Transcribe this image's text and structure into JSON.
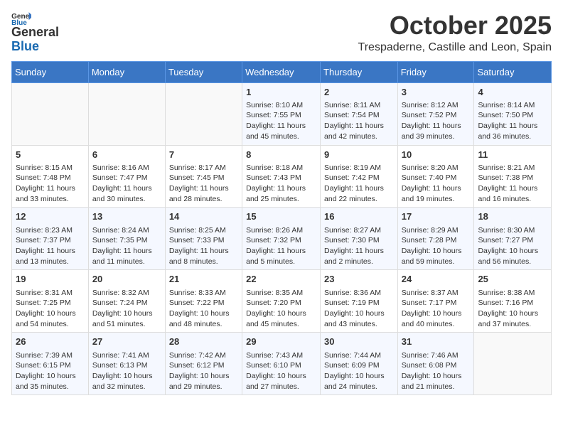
{
  "logo": {
    "general": "General",
    "blue": "Blue"
  },
  "header": {
    "month": "October 2025",
    "location": "Trespaderne, Castille and Leon, Spain"
  },
  "days_of_week": [
    "Sunday",
    "Monday",
    "Tuesday",
    "Wednesday",
    "Thursday",
    "Friday",
    "Saturday"
  ],
  "weeks": [
    [
      {
        "day": "",
        "info": ""
      },
      {
        "day": "",
        "info": ""
      },
      {
        "day": "",
        "info": ""
      },
      {
        "day": "1",
        "info": "Sunrise: 8:10 AM\nSunset: 7:55 PM\nDaylight: 11 hours and 45 minutes."
      },
      {
        "day": "2",
        "info": "Sunrise: 8:11 AM\nSunset: 7:54 PM\nDaylight: 11 hours and 42 minutes."
      },
      {
        "day": "3",
        "info": "Sunrise: 8:12 AM\nSunset: 7:52 PM\nDaylight: 11 hours and 39 minutes."
      },
      {
        "day": "4",
        "info": "Sunrise: 8:14 AM\nSunset: 7:50 PM\nDaylight: 11 hours and 36 minutes."
      }
    ],
    [
      {
        "day": "5",
        "info": "Sunrise: 8:15 AM\nSunset: 7:48 PM\nDaylight: 11 hours and 33 minutes."
      },
      {
        "day": "6",
        "info": "Sunrise: 8:16 AM\nSunset: 7:47 PM\nDaylight: 11 hours and 30 minutes."
      },
      {
        "day": "7",
        "info": "Sunrise: 8:17 AM\nSunset: 7:45 PM\nDaylight: 11 hours and 28 minutes."
      },
      {
        "day": "8",
        "info": "Sunrise: 8:18 AM\nSunset: 7:43 PM\nDaylight: 11 hours and 25 minutes."
      },
      {
        "day": "9",
        "info": "Sunrise: 8:19 AM\nSunset: 7:42 PM\nDaylight: 11 hours and 22 minutes."
      },
      {
        "day": "10",
        "info": "Sunrise: 8:20 AM\nSunset: 7:40 PM\nDaylight: 11 hours and 19 minutes."
      },
      {
        "day": "11",
        "info": "Sunrise: 8:21 AM\nSunset: 7:38 PM\nDaylight: 11 hours and 16 minutes."
      }
    ],
    [
      {
        "day": "12",
        "info": "Sunrise: 8:23 AM\nSunset: 7:37 PM\nDaylight: 11 hours and 13 minutes."
      },
      {
        "day": "13",
        "info": "Sunrise: 8:24 AM\nSunset: 7:35 PM\nDaylight: 11 hours and 11 minutes."
      },
      {
        "day": "14",
        "info": "Sunrise: 8:25 AM\nSunset: 7:33 PM\nDaylight: 11 hours and 8 minutes."
      },
      {
        "day": "15",
        "info": "Sunrise: 8:26 AM\nSunset: 7:32 PM\nDaylight: 11 hours and 5 minutes."
      },
      {
        "day": "16",
        "info": "Sunrise: 8:27 AM\nSunset: 7:30 PM\nDaylight: 11 hours and 2 minutes."
      },
      {
        "day": "17",
        "info": "Sunrise: 8:29 AM\nSunset: 7:28 PM\nDaylight: 10 hours and 59 minutes."
      },
      {
        "day": "18",
        "info": "Sunrise: 8:30 AM\nSunset: 7:27 PM\nDaylight: 10 hours and 56 minutes."
      }
    ],
    [
      {
        "day": "19",
        "info": "Sunrise: 8:31 AM\nSunset: 7:25 PM\nDaylight: 10 hours and 54 minutes."
      },
      {
        "day": "20",
        "info": "Sunrise: 8:32 AM\nSunset: 7:24 PM\nDaylight: 10 hours and 51 minutes."
      },
      {
        "day": "21",
        "info": "Sunrise: 8:33 AM\nSunset: 7:22 PM\nDaylight: 10 hours and 48 minutes."
      },
      {
        "day": "22",
        "info": "Sunrise: 8:35 AM\nSunset: 7:20 PM\nDaylight: 10 hours and 45 minutes."
      },
      {
        "day": "23",
        "info": "Sunrise: 8:36 AM\nSunset: 7:19 PM\nDaylight: 10 hours and 43 minutes."
      },
      {
        "day": "24",
        "info": "Sunrise: 8:37 AM\nSunset: 7:17 PM\nDaylight: 10 hours and 40 minutes."
      },
      {
        "day": "25",
        "info": "Sunrise: 8:38 AM\nSunset: 7:16 PM\nDaylight: 10 hours and 37 minutes."
      }
    ],
    [
      {
        "day": "26",
        "info": "Sunrise: 7:39 AM\nSunset: 6:15 PM\nDaylight: 10 hours and 35 minutes."
      },
      {
        "day": "27",
        "info": "Sunrise: 7:41 AM\nSunset: 6:13 PM\nDaylight: 10 hours and 32 minutes."
      },
      {
        "day": "28",
        "info": "Sunrise: 7:42 AM\nSunset: 6:12 PM\nDaylight: 10 hours and 29 minutes."
      },
      {
        "day": "29",
        "info": "Sunrise: 7:43 AM\nSunset: 6:10 PM\nDaylight: 10 hours and 27 minutes."
      },
      {
        "day": "30",
        "info": "Sunrise: 7:44 AM\nSunset: 6:09 PM\nDaylight: 10 hours and 24 minutes."
      },
      {
        "day": "31",
        "info": "Sunrise: 7:46 AM\nSunset: 6:08 PM\nDaylight: 10 hours and 21 minutes."
      },
      {
        "day": "",
        "info": ""
      }
    ]
  ]
}
